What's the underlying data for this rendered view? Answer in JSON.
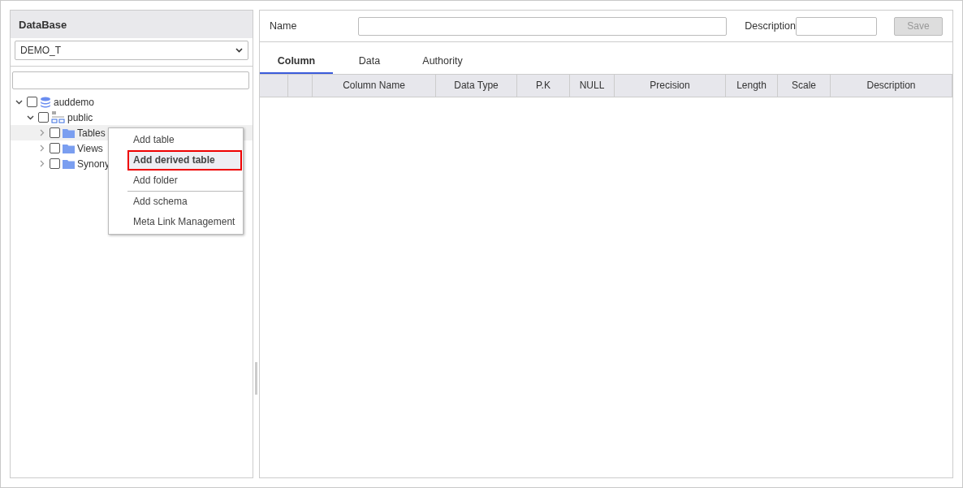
{
  "sidebar": {
    "title": "DataBase",
    "database_select": {
      "value": "DEMO_T"
    },
    "tree": [
      {
        "label": "auddemo",
        "kind": "database",
        "expanded": true,
        "checked": false,
        "selected": false,
        "children": [
          {
            "label": "public",
            "kind": "schema",
            "expanded": true,
            "checked": false,
            "selected": false,
            "children": [
              {
                "label": "Tables",
                "kind": "folder",
                "expanded": false,
                "checked": false,
                "selected": true
              },
              {
                "label": "Views",
                "kind": "folder",
                "expanded": false,
                "checked": false,
                "selected": false
              },
              {
                "label": "Synony",
                "kind": "folder",
                "expanded": false,
                "checked": false,
                "selected": false
              }
            ]
          }
        ]
      }
    ]
  },
  "context_menu": {
    "groups": [
      [
        {
          "label": "Add table",
          "selected": false
        },
        {
          "label": "Add derived table",
          "selected": true
        },
        {
          "label": "Add folder",
          "selected": false
        }
      ],
      [
        {
          "label": "Add schema",
          "selected": false
        },
        {
          "label": "Meta Link Management",
          "selected": false
        }
      ]
    ]
  },
  "form": {
    "name_label": "Name",
    "description_label": "Description",
    "save_button": {
      "label": "Save",
      "disabled": true
    }
  },
  "tabs": [
    {
      "label": "Column",
      "selected": true
    },
    {
      "label": "Data",
      "selected": false
    },
    {
      "label": "Authority",
      "selected": false
    }
  ],
  "table": {
    "columns": [
      "",
      "",
      "Column Name",
      "Data Type",
      "P.K",
      "NULL",
      "Precision",
      "Length",
      "Scale",
      "Description"
    ]
  }
}
